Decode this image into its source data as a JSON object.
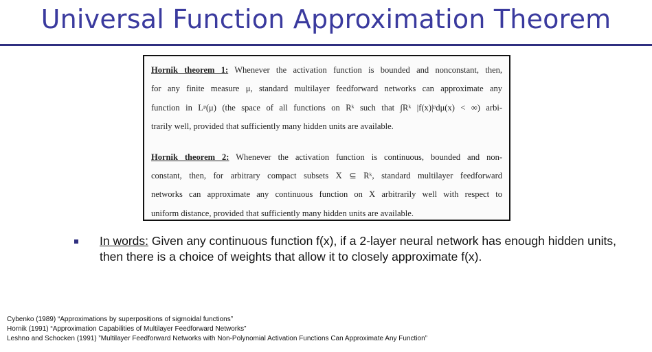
{
  "slide": {
    "title": "Universal Function Approximation Theorem"
  },
  "theorem1": {
    "label": "Hornik theorem 1:",
    "lines": [
      " Whenever the activation function is bounded and nonconstant, then,",
      "for any finite measure μ, standard multilayer feedforward networks can approximate any",
      "function in Lᵖ(μ) (the space of all functions on Rᵏ such that ∫Rᵏ |f(x)|ᵖdμ(x) < ∞) arbi-",
      "trarily well, provided that sufficiently many hidden units are available."
    ]
  },
  "theorem2": {
    "label": "Hornik theorem 2:",
    "lines": [
      " Whenever the activation function is continuous, bounded and non-",
      "constant, then, for arbitrary compact subsets X ⊆ Rᵏ, standard multilayer feedforward",
      "networks can approximate any continuous function on X arbitrarily well with respect to",
      "uniform distance, provided that sufficiently many hidden units are available."
    ]
  },
  "bullet": {
    "lead": "In words:",
    "text": " Given any continuous function f(x), if a 2-layer neural network has enough hidden units, then there is a choice of weights that allow it to closely approximate f(x)."
  },
  "references": [
    "Cybenko (1989) “Approximations by superpositions of sigmoidal functions”",
    "Hornik (1991) “Approximation Capabilities of Multilayer Feedforward Networks”",
    "Leshno and Schocken (1991) ”Multilayer Feedforward Networks with Non-Polynomial Activation Functions Can Approximate Any Function”"
  ],
  "colors": {
    "title": "#3a3a9e",
    "rule": "#2f2f80",
    "bullet": "#2f2f80"
  }
}
